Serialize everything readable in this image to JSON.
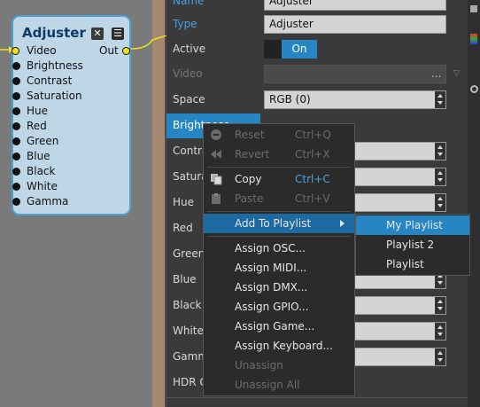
{
  "node": {
    "title": "Adjuster",
    "close_icon": "close-icon",
    "menu_icon": "hamburger-icon",
    "output_label": "Out",
    "ports": [
      "Video",
      "Brightness",
      "Contrast",
      "Saturation",
      "Hue",
      "Red",
      "Green",
      "Blue",
      "Black",
      "White",
      "Gamma"
    ]
  },
  "panel": {
    "top_field_text": "Adjuster",
    "rows": {
      "name": "Name",
      "type": "Type",
      "type_value": "Adjuster",
      "active": "Active",
      "active_value": "On",
      "video": "Video",
      "video_value": "...",
      "space": "Space",
      "space_value": "RGB (0)",
      "brightness": "Brightness",
      "contrast": "Contrast",
      "saturation": "Saturation",
      "hue": "Hue",
      "red": "Red",
      "green": "Green",
      "blue": "Blue",
      "black": "Black",
      "white": "White",
      "gamma": "Gamma",
      "hdr": "HDR Output"
    }
  },
  "context_menu": {
    "reset": "Reset",
    "reset_sc": "Ctrl+Q",
    "revert": "Revert",
    "revert_sc": "Ctrl+X",
    "copy": "Copy",
    "copy_sc": "Ctrl+C",
    "paste": "Paste",
    "paste_sc": "Ctrl+V",
    "add_to_playlist": "Add To Playlist",
    "assign_osc": "Assign OSC...",
    "assign_midi": "Assign MIDI...",
    "assign_dmx": "Assign DMX...",
    "assign_gpio": "Assign GPIO...",
    "assign_game": "Assign Game...",
    "assign_keyboard": "Assign Keyboard...",
    "unassign": "Unassign",
    "unassign_all": "Unassign All"
  },
  "submenu": {
    "items": [
      "My Playlist",
      "Playlist 2",
      "Playlist"
    ]
  },
  "colors": {
    "accent": "#2686c3",
    "node_border": "#4ba3d1",
    "node_bg": "#bfd6e6"
  }
}
